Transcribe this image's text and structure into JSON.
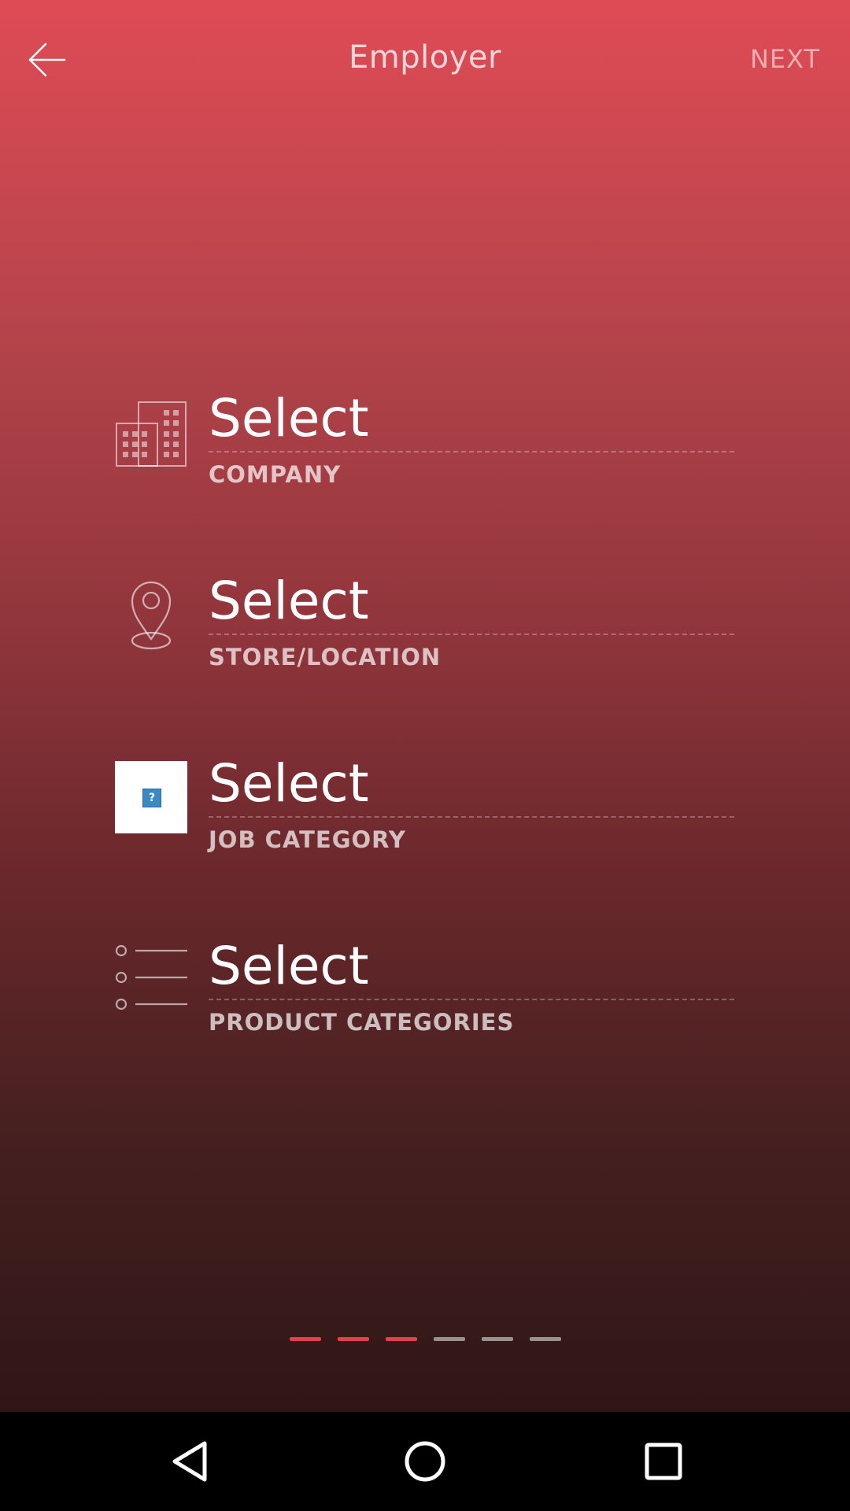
{
  "header": {
    "title": "Employer",
    "next_label": "NEXT"
  },
  "fields": [
    {
      "value": "Select",
      "label": "COMPANY",
      "icon": "building-icon"
    },
    {
      "value": "Select",
      "label": "STORE/LOCATION",
      "icon": "location-pin-icon"
    },
    {
      "value": "Select",
      "label": "JOB CATEGORY",
      "icon": "broken-image-icon"
    },
    {
      "value": "Select",
      "label": "PRODUCT CATEGORIES",
      "icon": "list-icon"
    }
  ],
  "progress": {
    "total_steps": 6,
    "completed_steps": 3,
    "active_color": "#e0414d",
    "inactive_color": "#9a9090"
  },
  "navbar": {
    "back": "back-triangle-icon",
    "home": "home-circle-icon",
    "recents": "recents-square-icon"
  }
}
